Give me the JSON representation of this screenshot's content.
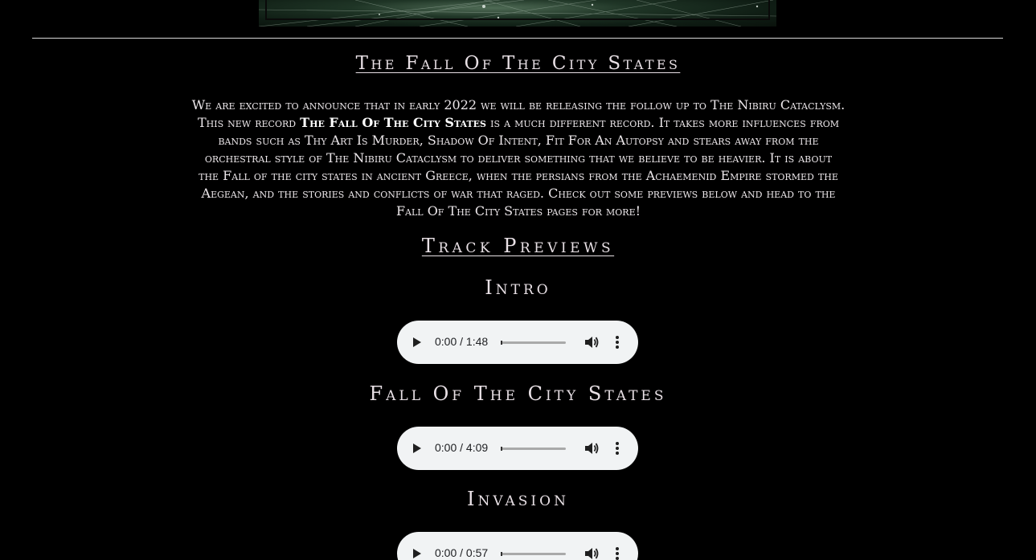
{
  "banner": {
    "icon": "album-artwork-banner"
  },
  "title": "The Fall Of The City States",
  "intro": {
    "line1": "We are excited to announce that in early 2022 we will be releasing the follow up to The Nibiru Cataclysm.",
    "line2_before": "This new record ",
    "line2_bold": "The Fall Of The City States",
    "line2_after": " is a much different record. It takes more influences from",
    "line3": "bands such as Thy Art Is Murder, Shadow Of Intent, Fit For An Autopsy and stears away from the",
    "line4": "orchestral style of The Nibiru Cataclysm to deliver something that we believe to be heavier. It is about",
    "line5": "the Fall of the city states in ancient Greece, when the persians from the Achaemenid Empire stormed the",
    "line6": "Aegean, and the stories and conflicts of war that raged. Check out some previews below and head to the",
    "line7": "Fall Of The City States pages for more!"
  },
  "previews_title": "Track Previews",
  "tracks": [
    {
      "title": "Intro",
      "time": "0:00 / 1:48",
      "progress": 0.0
    },
    {
      "title": "Fall Of The City States",
      "time": "0:00 / 4:09",
      "progress": 0.0
    },
    {
      "title": "Invasion",
      "time": "0:00 / 0:57",
      "progress": 0.0
    }
  ],
  "colors": {
    "background": "#000000",
    "text": "#e8e0e5",
    "player": "#f1f3f4"
  }
}
